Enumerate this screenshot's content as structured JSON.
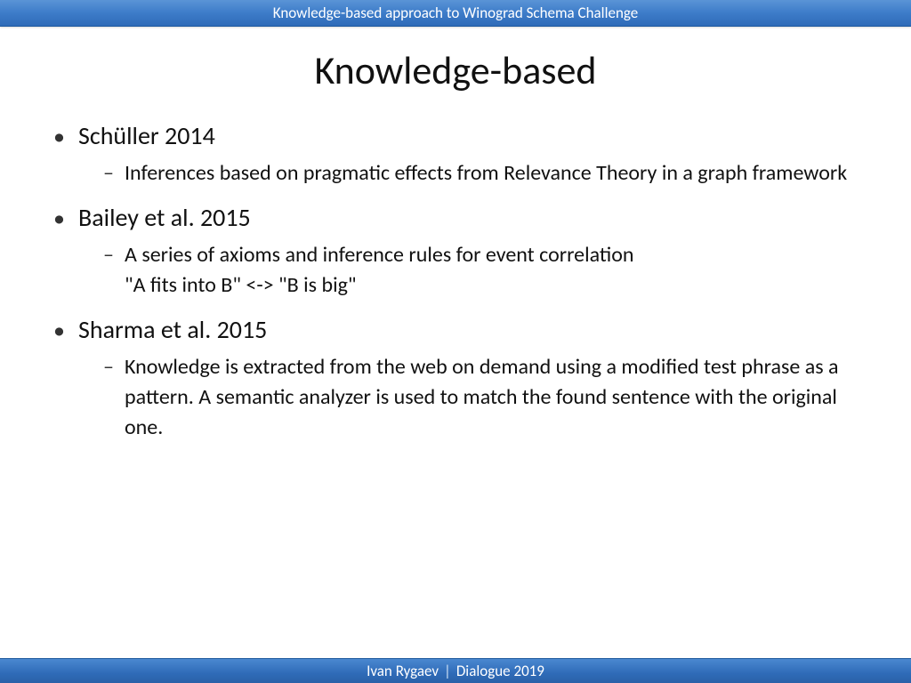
{
  "header": {
    "title": "Knowledge-based approach to Winograd  Schema Challenge"
  },
  "slide": {
    "title": "Knowledge-based",
    "items": [
      {
        "label": "Schüller 2014",
        "sub": [
          "Inferences based on pragmatic effects from Relevance Theory in a graph framework"
        ]
      },
      {
        "label": "Bailey et al. 2015",
        "sub": [
          "A series of axioms and inference rules for event correlation\n\"A fits into B\" <-> \"B is big\""
        ]
      },
      {
        "label": "Sharma et al. 2015",
        "sub": [
          "Knowledge is extracted from the web on demand using a modified test phrase as a pattern. A semantic analyzer is used to match the found sentence with the original one."
        ]
      }
    ]
  },
  "footer": {
    "author": "Ivan Rygaev",
    "separator": "|",
    "event": "Dialogue 2019"
  }
}
